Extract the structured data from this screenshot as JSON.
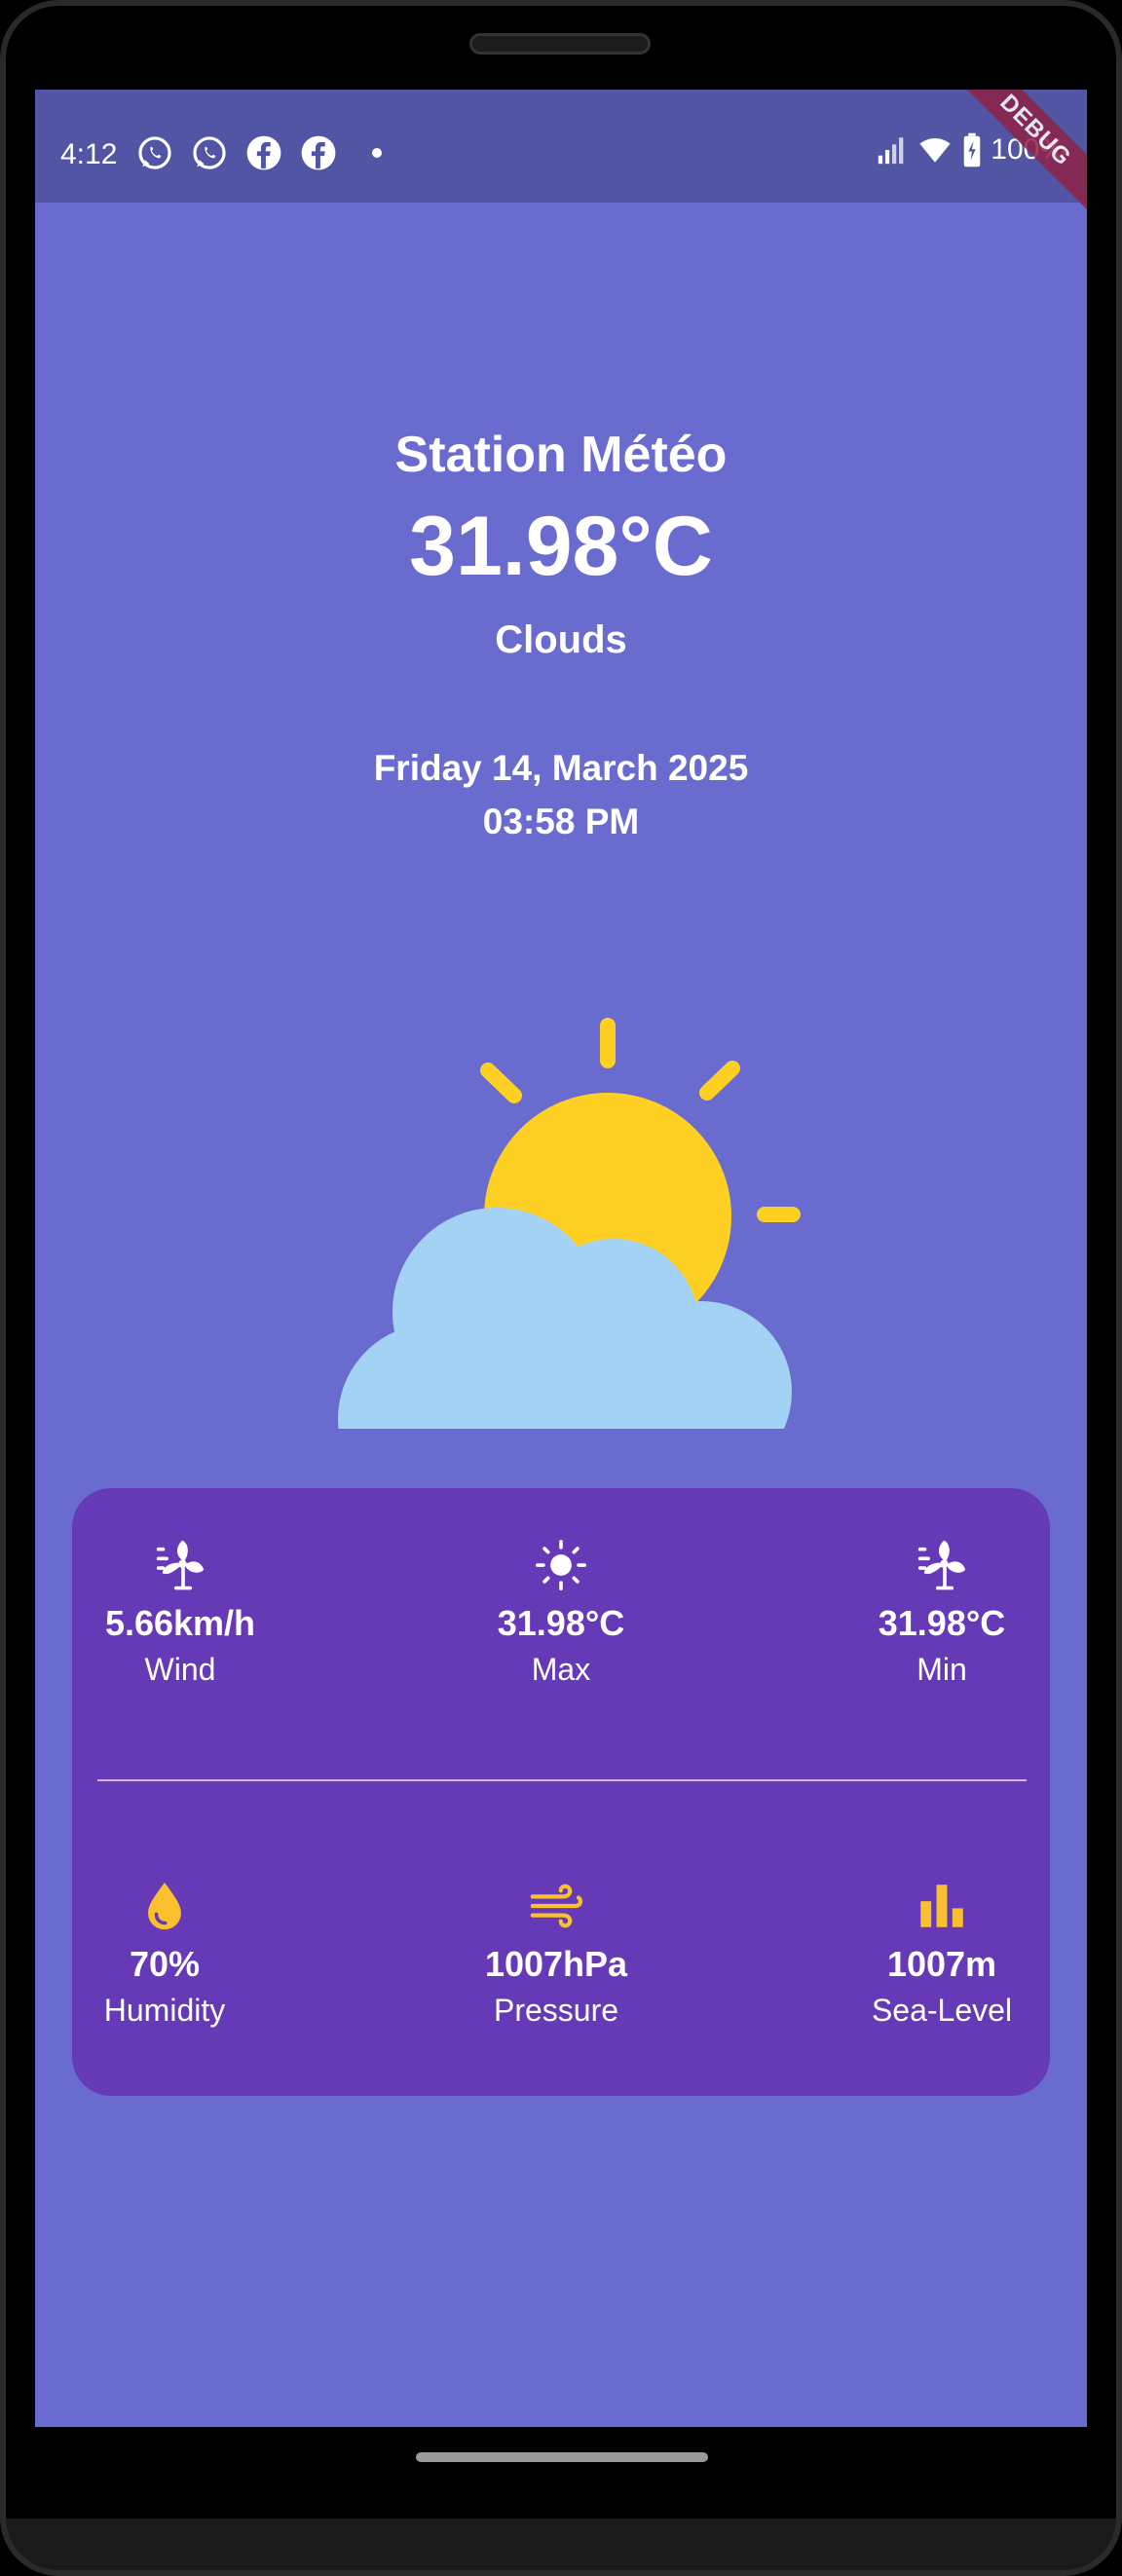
{
  "status_bar": {
    "time": "4:12",
    "notification_icons": [
      "whatsapp-icon",
      "whatsapp-icon",
      "facebook-icon",
      "facebook-icon"
    ],
    "battery": "100%",
    "debug_banner": "DEBUG"
  },
  "app": {
    "title": "Station Météo",
    "temperature": "31.98°C",
    "condition": "Clouds",
    "date": "Friday 14, March 2025",
    "time": "03:58 PM",
    "illustration": "sun-behind-cloud-icon"
  },
  "stats": {
    "row1": [
      {
        "icon": "fan-icon",
        "value": "5.66km/h",
        "label": "Wind"
      },
      {
        "icon": "sun-icon",
        "value": "31.98°C",
        "label": "Max"
      },
      {
        "icon": "fan-icon",
        "value": "31.98°C",
        "label": "Min"
      }
    ],
    "row2": [
      {
        "icon": "water-drop-icon",
        "value": "70%",
        "label": "Humidity"
      },
      {
        "icon": "air-icon",
        "value": "1007hPa",
        "label": "Pressure"
      },
      {
        "icon": "bar-chart-icon",
        "value": "1007m",
        "label": "Sea-Level"
      }
    ]
  },
  "colors": {
    "background": "#6a6bcf",
    "status_bar": "#5255a3",
    "card": "#663ab7",
    "sun": "#fdd023",
    "cloud": "#a3d2f5",
    "accent_icon": "#fbc02d"
  }
}
